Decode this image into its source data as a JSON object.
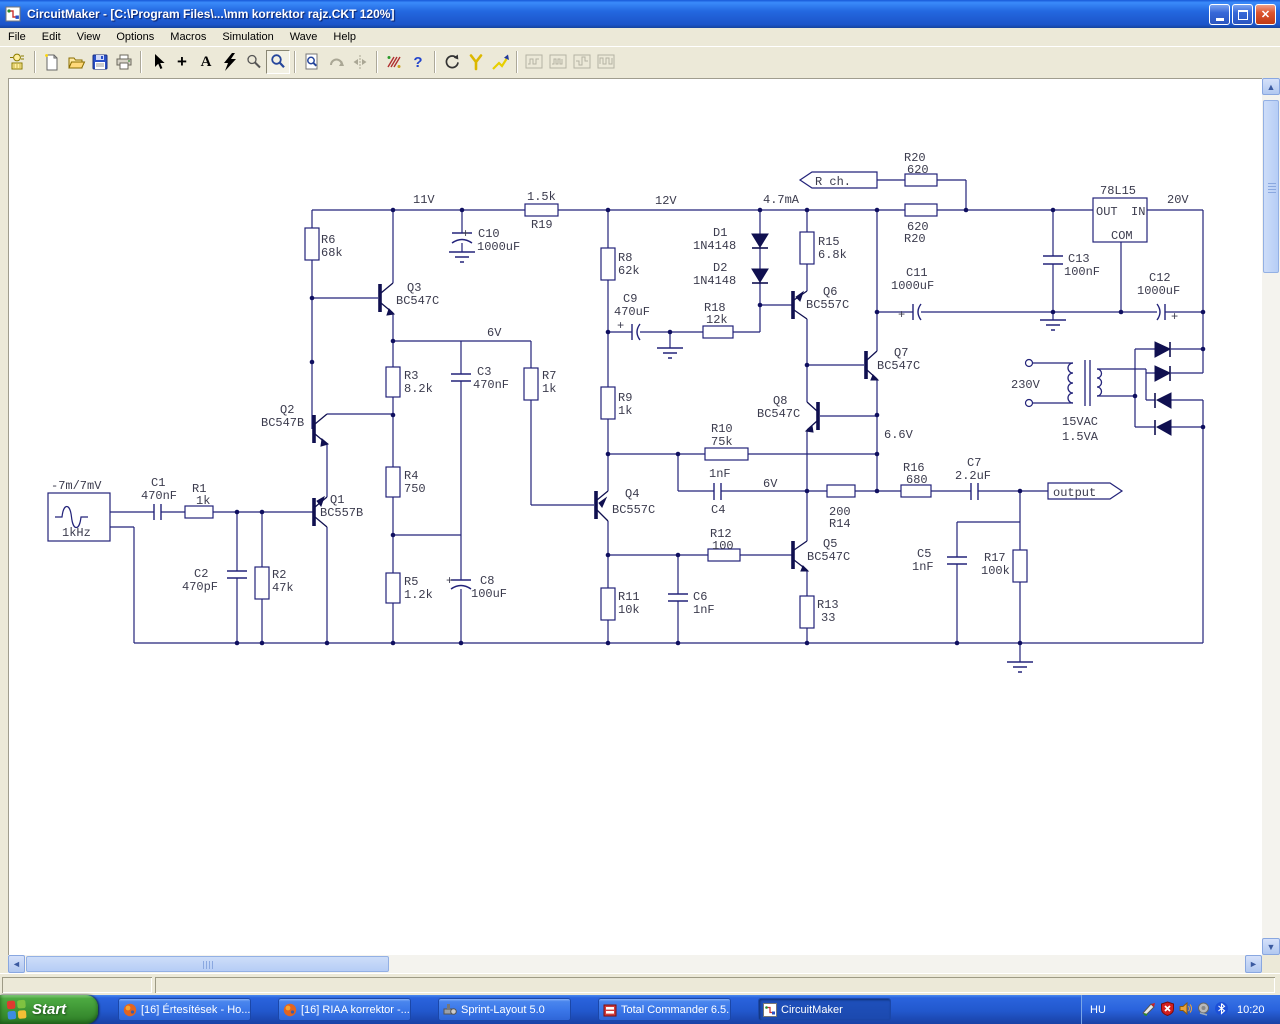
{
  "window": {
    "title": "CircuitMaker - [C:\\Program Files\\...\\mm korrektor rajz.CKT 120%]",
    "buttons": {
      "minimize": "minimize",
      "restore": "restore",
      "close": "close"
    }
  },
  "menu": {
    "items": [
      "File",
      "Edit",
      "View",
      "Options",
      "Macros",
      "Simulation",
      "Wave",
      "Help"
    ]
  },
  "toolbar": {
    "glyphs": {
      "plus": "+",
      "text": "A",
      "help": "?"
    },
    "buttons": [
      "parts-browser",
      "new",
      "open",
      "save",
      "print",
      "arrow-tool",
      "wire-tool",
      "text-tool",
      "delete-tool",
      "magnify-wand",
      "zoom-tool",
      "fit-page",
      "rotate",
      "mirror",
      "digital-analog",
      "help",
      "reset",
      "trace-tool",
      "probe",
      "wave-a",
      "wave-b",
      "wave-c",
      "wave-d"
    ],
    "pressed": "zoom-tool"
  },
  "schematic": {
    "labels": [
      [
        "-7m/7mV",
        51,
        489
      ],
      [
        "1kHz",
        62,
        536
      ],
      [
        "C1",
        151,
        486
      ],
      [
        "470nF",
        141,
        499
      ],
      [
        "R1",
        192,
        492
      ],
      [
        "1k",
        196,
        504
      ],
      [
        "C2",
        194,
        577
      ],
      [
        "470pF",
        182,
        590
      ],
      [
        "R2",
        272,
        578
      ],
      [
        "47k",
        272,
        591
      ],
      [
        "Q1",
        330,
        503
      ],
      [
        "BC557B",
        320,
        516
      ],
      [
        "Q2",
        280,
        413
      ],
      [
        "BC547B",
        261,
        426
      ],
      [
        "Q3",
        407,
        291
      ],
      [
        "BC547C",
        396,
        304
      ],
      [
        "R6",
        321,
        243
      ],
      [
        "68k",
        321,
        256
      ],
      [
        "11V",
        413,
        203
      ],
      [
        "+",
        462,
        237
      ],
      [
        "C10",
        478,
        237
      ],
      [
        "1000uF",
        477,
        250
      ],
      [
        "1.5k",
        527,
        200
      ],
      [
        "R19",
        531,
        228
      ],
      [
        "R3",
        404,
        379
      ],
      [
        "8.2k",
        404,
        392
      ],
      [
        "C3",
        477,
        375
      ],
      [
        "470nF",
        473,
        388
      ],
      [
        "6V",
        487,
        336
      ],
      [
        "R7",
        542,
        379
      ],
      [
        "1k",
        542,
        392
      ],
      [
        "R4",
        404,
        479
      ],
      [
        "750",
        404,
        492
      ],
      [
        "R5",
        404,
        585
      ],
      [
        "1.2k",
        404,
        598
      ],
      [
        "+",
        446,
        584
      ],
      [
        "C8",
        480,
        584
      ],
      [
        "100uF",
        471,
        597
      ],
      [
        "12V",
        655,
        204
      ],
      [
        "R8",
        618,
        261
      ],
      [
        "62k",
        618,
        274
      ],
      [
        "D1",
        713,
        236
      ],
      [
        "1N4148",
        693,
        249
      ],
      [
        "D2",
        713,
        271
      ],
      [
        "1N4148",
        693,
        284
      ],
      [
        "C9",
        623,
        302
      ],
      [
        "470uF",
        614,
        315
      ],
      [
        "+",
        617,
        329
      ],
      [
        "R18",
        704,
        311
      ],
      [
        "12k",
        706,
        323
      ],
      [
        "R9",
        618,
        401
      ],
      [
        "1k",
        618,
        414
      ],
      [
        "4.7mA",
        763,
        203
      ],
      [
        "R15",
        818,
        245
      ],
      [
        "6.8k",
        818,
        258
      ],
      [
        "Q6",
        823,
        295
      ],
      [
        "BC557C",
        806,
        308
      ],
      [
        "Q7",
        894,
        356
      ],
      [
        "BC547C",
        877,
        369
      ],
      [
        "Q8",
        773,
        404
      ],
      [
        "BC547C",
        757,
        417
      ],
      [
        "6.6V",
        884,
        438
      ],
      [
        "R10",
        711,
        432
      ],
      [
        "75k",
        711,
        445
      ],
      [
        "1nF",
        709,
        477
      ],
      [
        "C4",
        711,
        513
      ],
      [
        "6V",
        763,
        487
      ],
      [
        "200",
        829,
        515
      ],
      [
        "R14",
        829,
        527
      ],
      [
        "Q4",
        625,
        497
      ],
      [
        "BC557C",
        612,
        513
      ],
      [
        "R12",
        710,
        537
      ],
      [
        "100",
        712,
        549
      ],
      [
        "Q5",
        823,
        547
      ],
      [
        "BC547C",
        807,
        560
      ],
      [
        "R11",
        618,
        600
      ],
      [
        "10k",
        618,
        613
      ],
      [
        "C6",
        693,
        600
      ],
      [
        "1nF",
        693,
        613
      ],
      [
        "R13",
        817,
        608
      ],
      [
        "33",
        821,
        621
      ],
      [
        "R16",
        903,
        471
      ],
      [
        "680",
        906,
        483
      ],
      [
        "C7",
        967,
        466
      ],
      [
        "2.2uF",
        955,
        479
      ],
      [
        "C5",
        917,
        557
      ],
      [
        "1nF",
        912,
        570
      ],
      [
        "R17",
        984,
        561
      ],
      [
        "100k",
        981,
        574
      ],
      [
        "R20",
        904,
        161
      ],
      [
        "620",
        907,
        173
      ],
      [
        "620",
        907,
        230
      ],
      [
        "R20",
        904,
        242
      ],
      [
        "C11",
        906,
        276
      ],
      [
        "1000uF",
        891,
        289
      ],
      [
        "+",
        898,
        318
      ],
      [
        "C13",
        1068,
        262
      ],
      [
        "100nF",
        1064,
        275
      ],
      [
        "78L15",
        1100,
        194
      ],
      [
        "OUT",
        1096,
        215
      ],
      [
        "IN",
        1131,
        215
      ],
      [
        "COM",
        1111,
        239
      ],
      [
        "20V",
        1167,
        203
      ],
      [
        "C12",
        1149,
        281
      ],
      [
        "1000uF",
        1137,
        294
      ],
      [
        "+",
        1171,
        320
      ],
      [
        "230V",
        1011,
        388
      ],
      [
        "15VAC",
        1062,
        425
      ],
      [
        "1.5VA",
        1062,
        440
      ],
      [
        "R ch.",
        815,
        185
      ],
      [
        "output",
        1053,
        496
      ]
    ]
  },
  "statusbar": {
    "left": "",
    "right": ""
  },
  "taskbar": {
    "start_label": "Start",
    "tasks": [
      {
        "label": "[16] Értesítések - Ho...",
        "icon": "firefox-icon",
        "active": false
      },
      {
        "label": "[16] RIAA korrektor -...",
        "icon": "firefox-icon",
        "active": false
      },
      {
        "label": "Sprint-Layout 5.0",
        "icon": "sprint-layout-icon",
        "active": false
      },
      {
        "label": "Total Commander 6.5...",
        "icon": "total-commander-icon",
        "active": false
      },
      {
        "label": "CircuitMaker",
        "icon": "circuitmaker-icon",
        "active": true
      }
    ],
    "tray": {
      "language": "HU",
      "icons": [
        "pen-tablet-icon",
        "security-shield-icon",
        "volume-icon",
        "audio-device-icon",
        "bluetooth-icon"
      ],
      "clock": "10:20"
    }
  }
}
